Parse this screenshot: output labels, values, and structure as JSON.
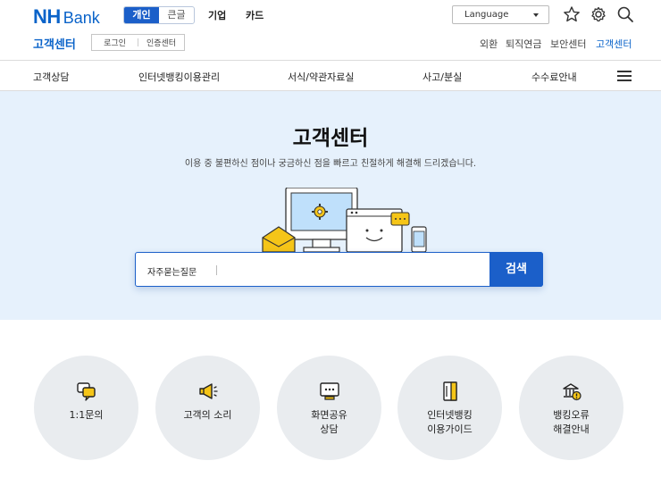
{
  "brand": {
    "nh": "NH",
    "bank": "Bank"
  },
  "segment": {
    "personal": "개인",
    "large": "큰글"
  },
  "topmenu": {
    "corporate": "기업",
    "card": "카드"
  },
  "language": {
    "label": "Language"
  },
  "icons": {
    "favorite": "star-icon",
    "settings": "gear-icon",
    "search": "search-icon",
    "menu": "hamburger-icon"
  },
  "subheader": {
    "title": "고객센터",
    "login": "로그인",
    "cert": "인증센터",
    "links": [
      "외환",
      "퇴직연금",
      "보안센터",
      "고객센터"
    ]
  },
  "nav": [
    "고객상담",
    "인터넷뱅킹이용관리",
    "서식/약관자료실",
    "사고/분실",
    "수수료안내"
  ],
  "hero": {
    "title": "고객센터",
    "subtitle": "이용 중 불편하신 점이나 궁금하신 점을 빠르고 친절하게 해결해 드리겠습니다.",
    "search_tag": "자주묻는질문",
    "search_value": "",
    "search_button": "검색"
  },
  "quick_links": [
    {
      "line1": "1:1문의",
      "line2": "",
      "icon": "chat-icon"
    },
    {
      "line1": "고객의 소리",
      "line2": "",
      "icon": "megaphone-icon"
    },
    {
      "line1": "화면공유",
      "line2": "상담",
      "icon": "monitor-icon"
    },
    {
      "line1": "인터넷뱅킹",
      "line2": "이용가이드",
      "icon": "book-icon"
    },
    {
      "line1": "뱅킹오류",
      "line2": "해결안내",
      "icon": "bank-alert-icon"
    }
  ],
  "colors": {
    "brand": "#0a63c9",
    "button": "#1b5fc9",
    "hero_bg": "#e6f1fc",
    "circle_bg": "#e9ecef",
    "accent_yellow": "#f5c518"
  }
}
